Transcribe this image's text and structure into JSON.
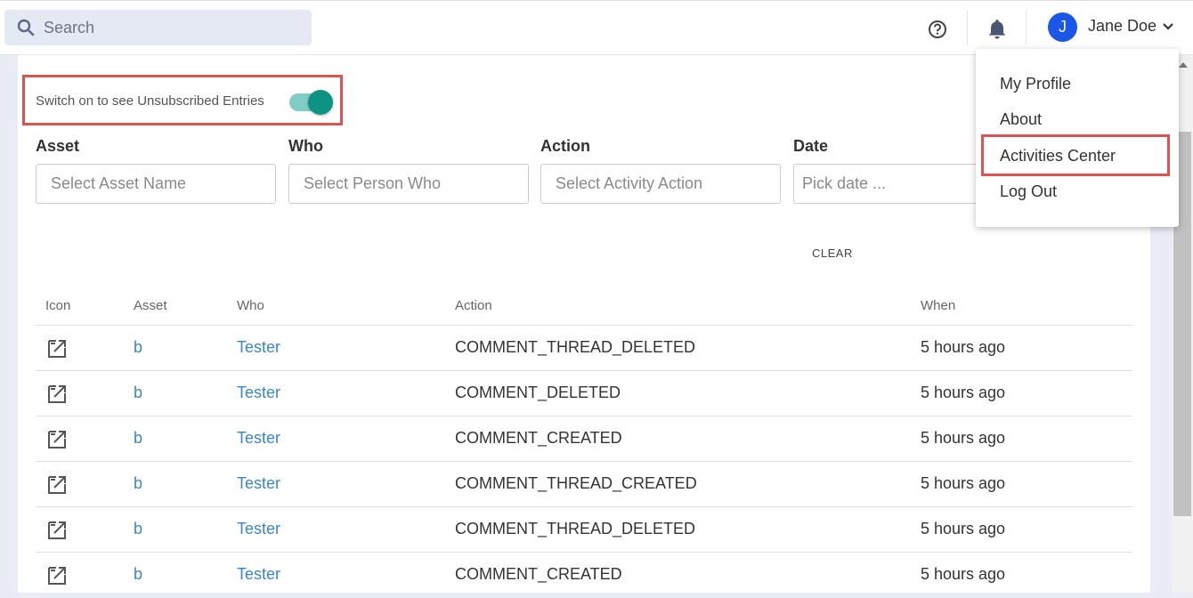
{
  "topbar": {
    "search_placeholder": "Search",
    "help_icon": "help-circle-icon",
    "bell_icon": "bell-icon",
    "user_initial": "J",
    "user_name": "Jane Doe"
  },
  "toggle": {
    "label": "Switch on to see Unsubscribed Entries",
    "on": true
  },
  "filters": {
    "asset_label": "Asset",
    "asset_placeholder": "Select Asset Name",
    "who_label": "Who",
    "who_placeholder": "Select Person Who",
    "action_label": "Action",
    "action_placeholder": "Select Activity Action",
    "date_label": "Date",
    "date_placeholder": "Pick date ..."
  },
  "clear_label": "CLEAR",
  "table": {
    "headers": {
      "icon": "Icon",
      "asset": "Asset",
      "who": "Who",
      "action": "Action",
      "when": "When"
    },
    "rows": [
      {
        "asset": "b",
        "who": "Tester",
        "action": "COMMENT_THREAD_DELETED",
        "when": "5 hours ago"
      },
      {
        "asset": "b",
        "who": "Tester",
        "action": "COMMENT_DELETED",
        "when": "5 hours ago"
      },
      {
        "asset": "b",
        "who": "Tester",
        "action": "COMMENT_CREATED",
        "when": "5 hours ago"
      },
      {
        "asset": "b",
        "who": "Tester",
        "action": "COMMENT_THREAD_CREATED",
        "when": "5 hours ago"
      },
      {
        "asset": "b",
        "who": "Tester",
        "action": "COMMENT_THREAD_DELETED",
        "when": "5 hours ago"
      },
      {
        "asset": "b",
        "who": "Tester",
        "action": "COMMENT_CREATED",
        "when": "5 hours ago"
      }
    ]
  },
  "user_menu": {
    "items": [
      "My Profile",
      "About",
      "Activities Center",
      "Log Out"
    ]
  },
  "colors": {
    "accent": "#0c9384",
    "link": "#3a86c8",
    "highlight": "#e05252",
    "avatar": "#1a56e8"
  }
}
